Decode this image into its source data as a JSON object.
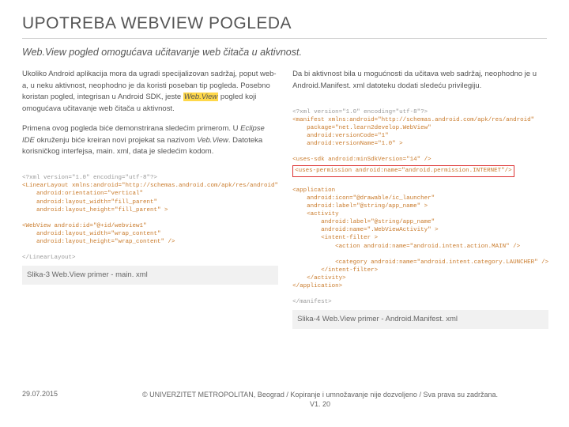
{
  "title": "UPOTREBA WEBVIEW POGLEDA",
  "subtitle": "Web.View pogled omogućava učitavanje web čitača u aktivnost.",
  "left": {
    "p1a": "Ukoliko Android aplikacija mora da ugradi specijalizovan sadržaj, poput web-a, u neku aktivnost, neophodno je da koristi poseban tip pogleda. Posebno koristan pogled, integrisan u Android SDK, jeste ",
    "p1hl": "Web.View",
    "p1b": " pogled koji omogućava učitavanje web čitača u aktivnost.",
    "p2a": "Primena ovog pogleda biće demonstrirana sledećim primerom. U ",
    "p2i": "Eclipse IDE",
    "p2b": " okruženju biće kreiran novi projekat sa nazivom ",
    "p2i2": "Veb.View",
    "p2c": ". Datoteka korisničkog interfejsa, main. xml, data je sledećim kodom.",
    "code1": "<?xml version=\"1.0\" encoding=\"utf-8\"?>",
    "code2": "<LinearLayout xmlns:android=\"http://schemas.android.com/apk/res/android\"",
    "code3": "    android:orientation=\"vertical\"",
    "code4": "    android:layout_width=\"fill_parent\"",
    "code5": "    android:layout_height=\"fill_parent\" >",
    "code6": "<WebView android:id=\"@+id/webview1\"",
    "code7": "    android:layout_width=\"wrap_content\"",
    "code8": "    android:layout_height=\"wrap_content\" />",
    "code9": "</LinearLayout>",
    "caption": "Slika-3 Web.View primer - main. xml"
  },
  "right": {
    "p1": "Da bi aktivnost bila u mogućnosti da učitava web sadržaj, neophodno je u Android.Manifest. xml datoteku dodati sledeću privilegiju.",
    "code1": "<?xml version=\"1.0\" encoding=\"utf-8\"?>",
    "code2": "<manifest xmlns:android=\"http://schemas.android.com/apk/res/android\"",
    "code3": "    package=\"net.learn2develop.WebView\"",
    "code4": "    android:versionCode=\"1\"",
    "code5": "    android:versionName=\"1.0\" >",
    "code6": "<uses-sdk android:minSdkVersion=\"14\" />",
    "codeRed": "<uses-permission android:name=\"android.permission.INTERNET\"/>",
    "code7": "<application",
    "code8": "    android:icon=\"@drawable/ic_launcher\"",
    "code9": "    android:label=\"@string/app_name\" >",
    "code10": "    <activity",
    "code11": "        android:label=\"@string/app_name\"",
    "code12": "        android:name=\".WebViewActivity\" >",
    "code13": "        <intent-filter >",
    "code14": "            <action android:name=\"android.intent.action.MAIN\" />",
    "code15": "            <category android:name=\"android.intent.category.LAUNCHER\" />",
    "code16": "        </intent-filter>",
    "code17": "    </activity>",
    "code18": "</application>",
    "code19": "</manifest>",
    "caption": "Slika-4 Web.View primer - Android.Manifest. xml"
  },
  "footer": {
    "date": "29.07.2015",
    "copy": "© UNIVERZITET METROPOLITAN, Beograd / Kopiranje i umnožavanje nije dozvoljeno / Sva prava su zadržana.",
    "ver": "V1. 20"
  }
}
